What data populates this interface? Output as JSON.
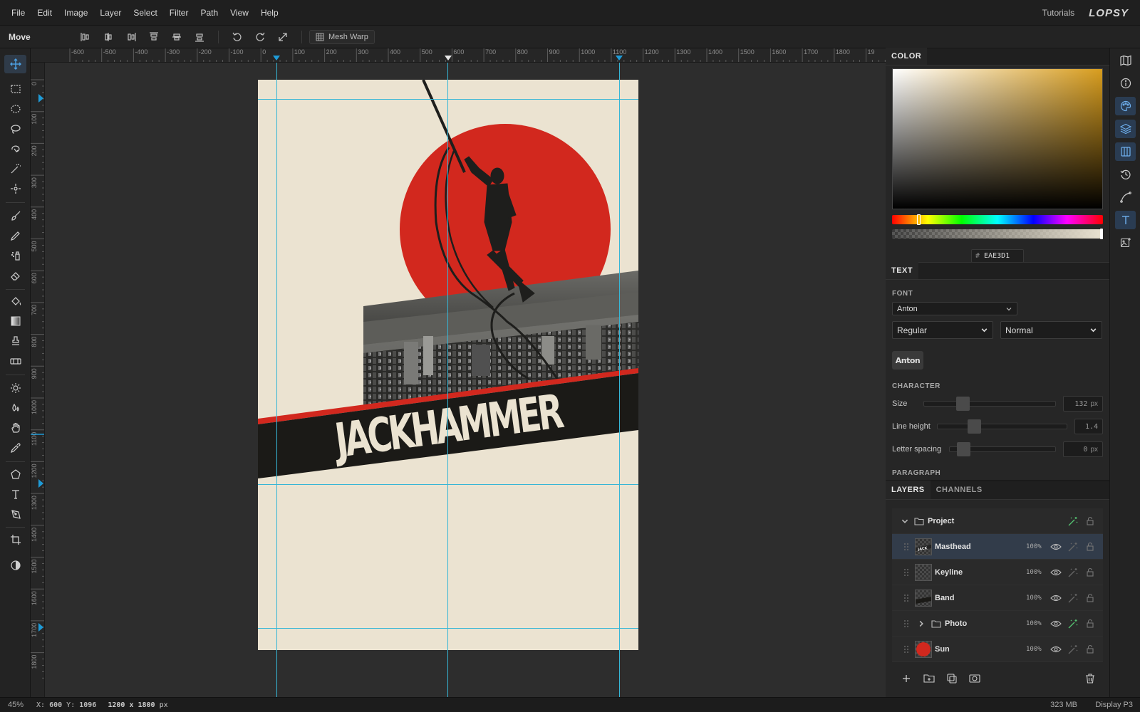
{
  "menu": {
    "items": [
      "File",
      "Edit",
      "Image",
      "Layer",
      "Select",
      "Filter",
      "Path",
      "View",
      "Help"
    ],
    "tutorials": "Tutorials",
    "logo": "LOPSY"
  },
  "options": {
    "tool_name": "Move",
    "mesh_warp": "Mesh Warp"
  },
  "ruler": {
    "top_labels": [
      "-600",
      "-500",
      "-400",
      "-300",
      "-200",
      "-100",
      "0",
      "100",
      "200",
      "300",
      "400",
      "500",
      "600",
      "700",
      "800",
      "900",
      "1000",
      "1100",
      "1200",
      "1300",
      "1400",
      "1500",
      "1600",
      "1700",
      "1800",
      "19"
    ],
    "left_labels": [
      "0",
      "100",
      "200",
      "300",
      "400",
      "500",
      "600",
      "700",
      "800",
      "900",
      "1000",
      "1100",
      "1200",
      "1300",
      "1400",
      "1500",
      "1600",
      "1700",
      "1800"
    ]
  },
  "document": {
    "headline": "JACKHAMMER",
    "background": "#EBE3D1",
    "sun_color": "#D2281E",
    "band_color": "#1B1A17"
  },
  "color_panel": {
    "tab": "COLOR",
    "hex_symbol": "#",
    "hex": "EAE3D1"
  },
  "text_panel": {
    "tab": "TEXT",
    "font_section": "FONT",
    "font_family": "Anton",
    "font_style": "Regular",
    "font_case": "Normal",
    "preview": "Anton",
    "character_section": "CHARACTER",
    "size_label": "Size",
    "size_value": "132",
    "size_unit": "px",
    "line_height_label": "Line height",
    "line_height_value": "1.4",
    "letter_spacing_label": "Letter spacing",
    "letter_spacing_value": "0",
    "letter_spacing_unit": "px",
    "paragraph_section": "PARAGRAPH"
  },
  "layers_panel": {
    "tabs": [
      "LAYERS",
      "CHANNELS"
    ],
    "group": "Project",
    "layers": [
      {
        "name": "Masthead",
        "opacity": "100%"
      },
      {
        "name": "Keyline",
        "opacity": "100%"
      },
      {
        "name": "Band",
        "opacity": "100%"
      },
      {
        "name": "Photo",
        "opacity": "100%"
      },
      {
        "name": "Sun",
        "opacity": "100%"
      }
    ]
  },
  "status": {
    "zoom": "45%",
    "x_label": "X:",
    "x": "600",
    "y_label": "Y:",
    "y": "1096",
    "dimensions": "1200 x 1800",
    "unit": "px",
    "memory": "323 MB",
    "profile": "Display P3"
  }
}
